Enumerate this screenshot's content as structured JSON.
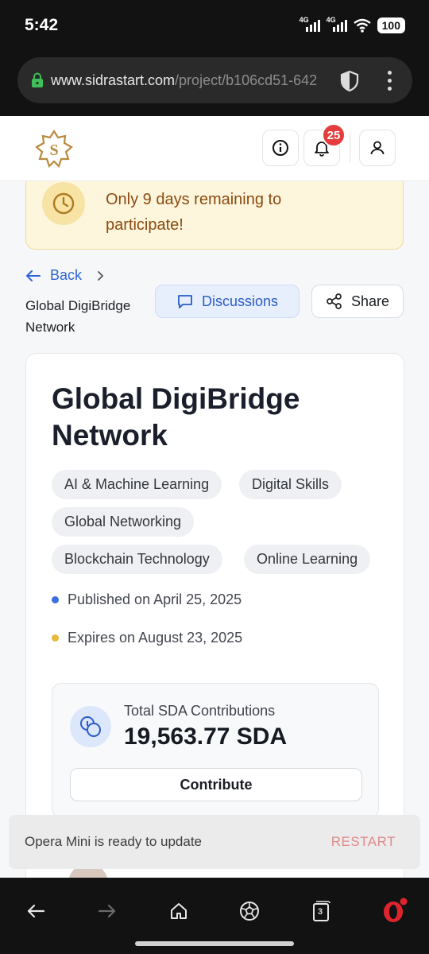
{
  "status_bar": {
    "time": "5:42",
    "signal_1": "4G",
    "signal_2": "4G",
    "battery": "100"
  },
  "browser": {
    "url_domain": "www.sidrastart.com",
    "url_path": "/project/b106cd51-642"
  },
  "header": {
    "notification_count": "25"
  },
  "alert": {
    "text": "Only 9 days remaining to participate!"
  },
  "breadcrumb": {
    "back_label": "Back",
    "current": "Global DigiBridge Network"
  },
  "actions": {
    "discussions_label": "Discussions",
    "share_label": "Share"
  },
  "project": {
    "title": "Global DigiBridge Network",
    "tags": [
      "AI & Machine Learning",
      "Digital Skills",
      "Global Networking",
      "Blockchain Technology",
      "Online Learning"
    ],
    "published": "Published on April 25, 2025",
    "expires": "Expires on August 23, 2025",
    "published_dot_color": "#3b6fe0",
    "expires_dot_color": "#e8b93a"
  },
  "contributions": {
    "label": "Total SDA Contributions",
    "amount": "19,563.77 SDA",
    "button_label": "Contribute"
  },
  "toast": {
    "message": "Opera Mini is ready to update",
    "action": "RESTART"
  },
  "bottom_nav": {
    "tabs_count": "3"
  },
  "colors": {
    "accent_blue": "#2e64d6",
    "alert_bg": "#fdf6dc",
    "alert_text": "#8a4a10",
    "badge_red": "#e43d3d",
    "opera_red": "#e0242e"
  }
}
